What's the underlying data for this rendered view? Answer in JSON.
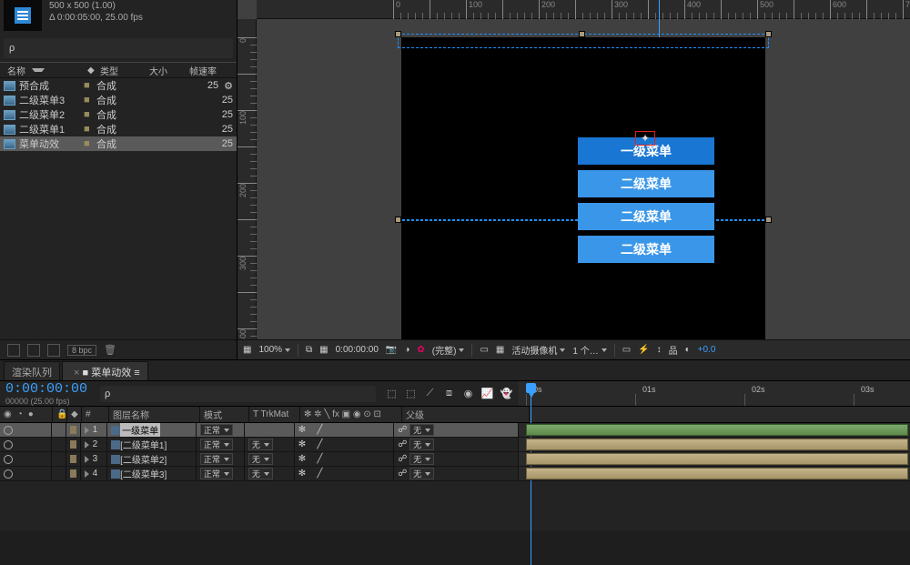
{
  "proj": {
    "title": "菜单动效",
    "size_line": "500 x 500 (1.00)",
    "dur_line": "Δ 0:00:05:00, 25.00 fps",
    "search_placeholder": "ρ",
    "cols": {
      "name": "名称",
      "tag_title": "标签",
      "type": "类型",
      "size": "大小",
      "fps": "帧速率"
    },
    "items": [
      {
        "name": "预合成",
        "type": "合成",
        "fps": "25"
      },
      {
        "name": "二级菜单3",
        "type": "合成",
        "fps": "25"
      },
      {
        "name": "二级菜单2",
        "type": "合成",
        "fps": "25"
      },
      {
        "name": "二级菜单1",
        "type": "合成",
        "fps": "25"
      },
      {
        "name": "菜单动效",
        "type": "合成",
        "fps": "25"
      }
    ],
    "bpc": "8 bpc"
  },
  "viewer": {
    "menus": [
      "一级菜单",
      "二级菜单",
      "二级菜单",
      "二级菜单"
    ],
    "foot": {
      "zoom": "100%",
      "time": "0:00:00:00",
      "res": "(完整)",
      "camera": "活动摄像机",
      "views": "1 个…",
      "exposure": "+0.0"
    }
  },
  "timeline": {
    "tabs": {
      "render": "渲染队列",
      "active": "菜单动效"
    },
    "timecode": "0:00:00:00",
    "sub": "00000 (25.00 fps)",
    "cols": {
      "idx": "#",
      "layer": "图层名称",
      "mode": "模式",
      "trk": "T  TrkMat",
      "parent": "父级"
    },
    "marks": [
      "0s",
      "01s",
      "02s",
      "03s"
    ],
    "mode_val": "正常",
    "trk_val": "无",
    "parent_val": "无",
    "layers": [
      {
        "n": "1",
        "name": "一级菜单",
        "linked": false,
        "sel": true
      },
      {
        "n": "2",
        "name": "[二级菜单1]",
        "linked": true
      },
      {
        "n": "3",
        "name": "[二级菜单2]",
        "linked": true
      },
      {
        "n": "4",
        "name": "[二级菜单3]",
        "linked": true
      }
    ]
  }
}
